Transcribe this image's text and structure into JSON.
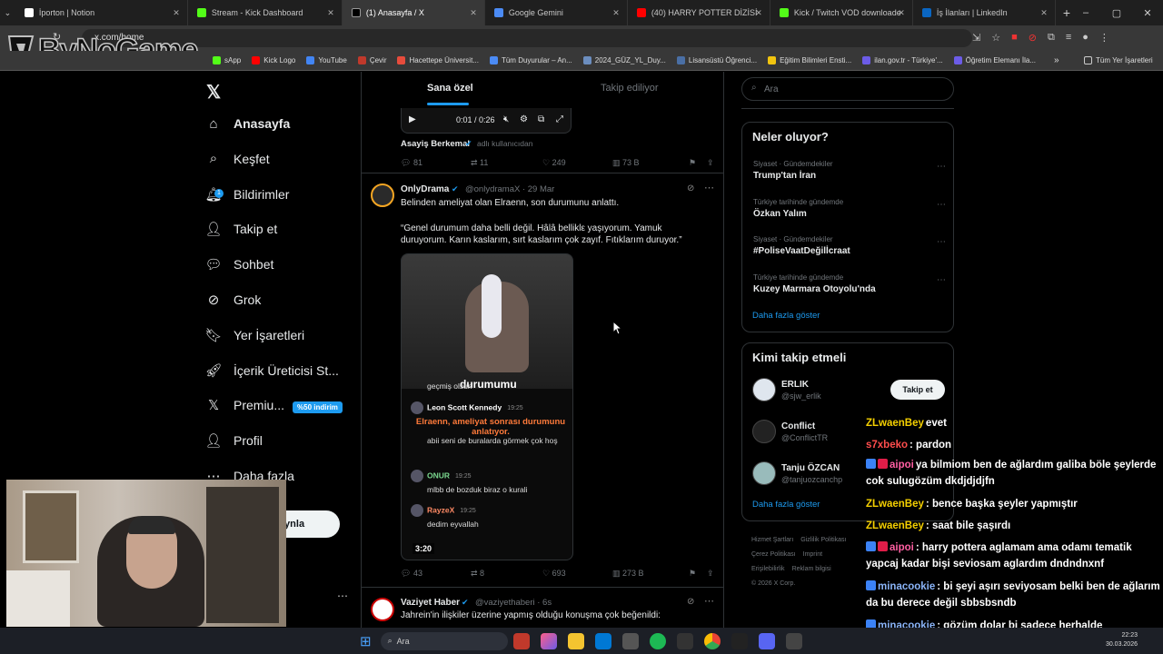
{
  "tabs": [
    {
      "title": "İporton | Notion",
      "color": "#ffffff"
    },
    {
      "title": "Stream - Kick Dashboard",
      "color": "#53fc18"
    },
    {
      "title": "(1) Anasayfa / X",
      "color": "#000000"
    },
    {
      "title": "Google Gemini",
      "color": "#4b8bf5"
    },
    {
      "title": "(40) HARRY POTTER DİZİSİ FRA",
      "color": "#ff0000"
    },
    {
      "title": "Kick / Twitch VOD downloader",
      "color": "#53fc18"
    },
    {
      "title": "İş İlanları | LinkedIn",
      "color": "#0a66c2"
    }
  ],
  "address": "x.com/home",
  "watermark": "ByNoGame",
  "bookmarks": [
    "sApp",
    "Kick Logo",
    "YouTube",
    "Çevir",
    "Hacettepe Üniversit...",
    "Tüm Duyurular – An...",
    "2024_GÜZ_YL_Duy...",
    "Lisansüstü Öğrenci...",
    "Eğitim Bilimleri Ensti...",
    "ilan.gov.tr - Türkiye'...",
    "Öğretim Elemanı İla..."
  ],
  "all_bookmarks": "Tüm Yer İşaretleri",
  "nav": [
    "Anasayfa",
    "Keşfet",
    "Bildirimler",
    "Takip et",
    "Sohbet",
    "Grok",
    "Yer İşaretleri",
    "İçerik Üreticisi St...",
    "Premiu...",
    "Profil",
    "Daha fazla"
  ],
  "premium_badge": "%50 indirim",
  "post_button": "ıynla",
  "notif_count": "1",
  "feed_tabs": {
    "for_you": "Sana özel",
    "following": "Takip ediliyor"
  },
  "video_time": "0:01 / 0:26",
  "tweet0": {
    "name": "Asayiş Berkemal",
    "handle": "adlı kullanıcıdan",
    "replies": "81",
    "retweets": "11",
    "likes": "249",
    "views": "73 B"
  },
  "tweet1": {
    "name": "OnlyDrama",
    "handle": "@onlydramaX · 29 Mar",
    "line1": "Belinden ameliyat olan Elraenn, son durumunu anlattı.",
    "quote": "“Genel durumum daha belli değil. Hâlâ belliklε yaşıyorum. Yamuk duruyorum. Karın kaslarım, sırt kaslarım çok zayıf. Fıtıklarım duruyor.”",
    "replies": "43",
    "retweets": "8",
    "likes": "693",
    "views": "273 B",
    "media_caption": "durumumu",
    "media_duration": "3:20",
    "media_chat": [
      {
        "user": "",
        "text": "geçmiş olsun"
      },
      {
        "user": "Leon Scott Kennedy",
        "time": "19:25",
        "text": "Elraenn, ameliyat sonrası durumunu anlatıyor."
      },
      {
        "user": "",
        "text": "abii seni de buralarda görmek çok hoş"
      },
      {
        "user": "ONUR",
        "time": "19:25",
        "text": "mlbb de bozduk biraz o kurali"
      },
      {
        "user": "RayzeX",
        "time": "19:25",
        "text": "dedim eyvallah"
      }
    ]
  },
  "tweet2": {
    "name": "Vaziyet Haber",
    "handle": "@vaziyethaberi · 6s",
    "text": "Jahrein'in ilişkiler üzerine yapmış olduğu konuşma çok beğenildi:"
  },
  "search_placeholder": "Ara",
  "trends_title": "Neler oluyor?",
  "trends": [
    {
      "cat": "Siyaset · Gündemdekiler",
      "title": "Trump'tan İran"
    },
    {
      "cat": "Türkiye tarihinde gündemde",
      "title": "Özkan Yalım"
    },
    {
      "cat": "Siyaset · Gündemdekiler",
      "title": "#PoliseVaatDeğilİcraat"
    },
    {
      "cat": "Türkiye tarihinde gündemde",
      "title": "Kuzey Marmara Otoyolu'nda"
    }
  ],
  "show_more": "Daha fazla göster",
  "who_title": "Kimi takip etmeli",
  "who": [
    {
      "name": "ERLIK",
      "handle": "@sjw_erlik"
    },
    {
      "name": "Conflict",
      "handle": "@ConflictTR"
    },
    {
      "name": "Tanju ÖZCAN",
      "handle": "@tanjuozcanchp"
    }
  ],
  "follow_label": "Takip et",
  "footer": [
    "Hizmet Şartları",
    "Gizlilik Politikası",
    "Çerez Politikası",
    "Imprint",
    "Erişilebilirlik",
    "Reklam bilgisi",
    "© 2026 X Corp."
  ],
  "chat": [
    {
      "user": "ZLwaenBey",
      "color": "#f5d000",
      "text": "evet",
      "badge": ""
    },
    {
      "user": "s7xbeko",
      "color": "#ff4d4d",
      "text": ": pardon",
      "badge": ""
    },
    {
      "user": "aipoi",
      "color": "#ff5fa2",
      "text": "ya bilmiom ben de ağlardım galiba böle şeylerde cok sulugözüm dkdjdjdjfn",
      "badge": "b"
    },
    {
      "user": "ZLwaenBey",
      "color": "#f5d000",
      "text": ": bence başka şeyler yapmıştır",
      "badge": ""
    },
    {
      "user": "ZLwaenBey",
      "color": "#f5d000",
      "text": ": saat bile şaşırdı",
      "badge": ""
    },
    {
      "user": "aipoi",
      "color": "#ff5fa2",
      "text": ": harry pottera aglamam ama odamı tematik yapcaj kadar bişi seviosam aglardım dndndnxnf",
      "badge": "b"
    },
    {
      "user": "minacookie",
      "color": "#8ab4f8",
      "text": ": bi şeyi aşırı seviyosam belki ben de ağlarım da bu derece değil sbbsbsndb",
      "badge": "a"
    },
    {
      "user": "minacookie",
      "color": "#8ab4f8",
      "text": ": gözüm dolar bi sadece herhalde ndbdndnmd",
      "badge": "a"
    }
  ],
  "taskbar_search": "Ara",
  "clock": {
    "time": "22:23",
    "date": "30.03.2026"
  }
}
